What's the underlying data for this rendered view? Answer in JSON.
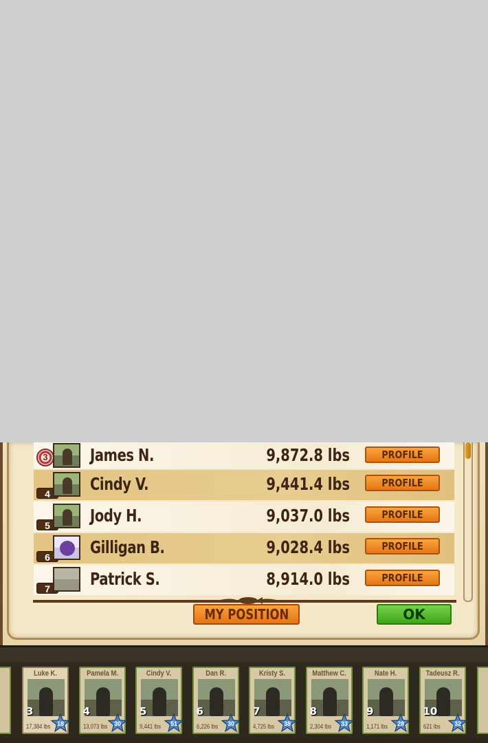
{
  "leaderboard": {
    "rows": [
      {
        "rank": "3",
        "name": "James N.",
        "score": "9,872.8 lbs",
        "profile_label": "PROFILE",
        "style": "medal"
      },
      {
        "rank": "4",
        "name": "Cindy V.",
        "score": "9,441.4 lbs",
        "profile_label": "PROFILE",
        "style": "badge"
      },
      {
        "rank": "5",
        "name": "Jody H.",
        "score": "9,037.0 lbs",
        "profile_label": "PROFILE",
        "style": "badge"
      },
      {
        "rank": "6",
        "name": "Gilligan B.",
        "score": "9,028.4 lbs",
        "profile_label": "PROFILE",
        "style": "badge"
      },
      {
        "rank": "7",
        "name": "Patrick S.",
        "score": "8,914.0 lbs",
        "profile_label": "PROFILE",
        "style": "badge"
      }
    ],
    "my_position_label": "MY POSITION",
    "ok_label": "OK"
  },
  "friends": {
    "cards": [
      {
        "name": "Luke K.",
        "rank": "3",
        "score": "17,384 lbs",
        "level": "18"
      },
      {
        "name": "Pamela M.",
        "rank": "4",
        "score": "13,073 lbs",
        "level": "30"
      },
      {
        "name": "Cindy V.",
        "rank": "5",
        "score": "9,441 lbs",
        "level": "51"
      },
      {
        "name": "Dan R.",
        "rank": "6",
        "score": "6,226 lbs",
        "level": "30"
      },
      {
        "name": "Kristy S.",
        "rank": "7",
        "score": "4,725 lbs",
        "level": "38"
      },
      {
        "name": "Matthew C.",
        "rank": "8",
        "score": "2,304 lbs",
        "level": "33"
      },
      {
        "name": "Nate H.",
        "rank": "9",
        "score": "1,171 lbs",
        "level": "28"
      },
      {
        "name": "Tadeusz R.",
        "rank": "10",
        "score": "621 lbs",
        "level": "32"
      }
    ]
  },
  "colors": {
    "profile_button": "#e77614",
    "ok_button": "#3fa619",
    "text_brown": "#3d2516"
  }
}
